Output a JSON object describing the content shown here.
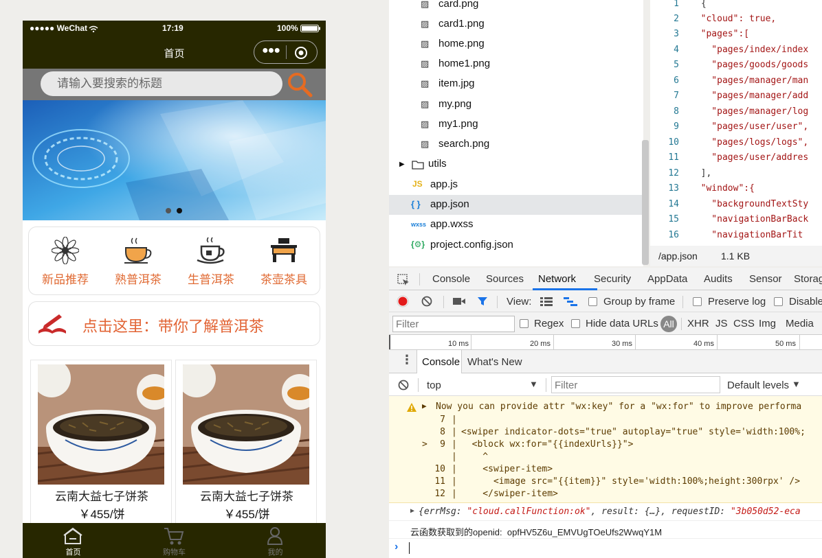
{
  "phone": {
    "status": {
      "carrier": "●●●●● WeChat",
      "time": "17:19",
      "battery": "100%"
    },
    "nav_title": "首页",
    "search_placeholder": "请输入要搜索的标题",
    "categories": [
      {
        "label": "新品推荐",
        "icon": "flower-icon"
      },
      {
        "label": "熟普洱茶",
        "icon": "hot-tea-cup-icon"
      },
      {
        "label": "生普洱茶",
        "icon": "teapot-icon"
      },
      {
        "label": "茶壶茶具",
        "icon": "tea-table-icon"
      }
    ],
    "promo_text": "点击这里：带你了解普洱茶",
    "products": [
      {
        "name": "云南大益七子饼茶",
        "price": "￥455/饼"
      },
      {
        "name": "云南大益七子饼茶",
        "price": "￥455/饼"
      }
    ],
    "tabs": [
      {
        "label": "首页",
        "icon": "home-icon",
        "active": true
      },
      {
        "label": "购物车",
        "icon": "cart-icon",
        "active": false
      },
      {
        "label": "我的",
        "icon": "user-icon",
        "active": false
      }
    ],
    "colors": {
      "navbar": "#272700",
      "accent": "#e06a33"
    }
  },
  "file_tree": {
    "items": [
      {
        "name": "card.png",
        "type": "image"
      },
      {
        "name": "card1.png",
        "type": "image"
      },
      {
        "name": "home.png",
        "type": "image"
      },
      {
        "name": "home1.png",
        "type": "image"
      },
      {
        "name": "item.jpg",
        "type": "image"
      },
      {
        "name": "my.png",
        "type": "image"
      },
      {
        "name": "my1.png",
        "type": "image"
      },
      {
        "name": "search.png",
        "type": "image"
      },
      {
        "name": "utils",
        "type": "folder"
      },
      {
        "name": "app.js",
        "type": "js"
      },
      {
        "name": "app.json",
        "type": "json",
        "selected": true
      },
      {
        "name": "app.wxss",
        "type": "wxss"
      },
      {
        "name": "project.config.json",
        "type": "config"
      }
    ],
    "type_labels": {
      "js": "JS",
      "json": "{ }",
      "wxss": "wxss",
      "config": "{⚙}"
    }
  },
  "editor": {
    "lines": [
      {
        "n": "1",
        "text": "{"
      },
      {
        "n": "2",
        "text": "  \"cloud\": true,"
      },
      {
        "n": "3",
        "text": "  \"pages\":["
      },
      {
        "n": "4",
        "text": "    \"pages/index/index"
      },
      {
        "n": "5",
        "text": "    \"pages/goods/goods"
      },
      {
        "n": "6",
        "text": "    \"pages/manager/man"
      },
      {
        "n": "7",
        "text": "    \"pages/manager/add"
      },
      {
        "n": "8",
        "text": "    \"pages/manager/log"
      },
      {
        "n": "9",
        "text": "    \"pages/user/user\","
      },
      {
        "n": "10",
        "text": "    \"pages/logs/logs\","
      },
      {
        "n": "11",
        "text": "    \"pages/user/addres"
      },
      {
        "n": "12",
        "text": "  ],"
      },
      {
        "n": "13",
        "text": "  \"window\":{"
      },
      {
        "n": "14",
        "text": "    \"backgroundTextSty"
      },
      {
        "n": "15",
        "text": "    \"navigationBarBack"
      },
      {
        "n": "16",
        "text": "    \"navigationBarTit"
      }
    ],
    "status_path": "/app.json",
    "status_size": "1.1 KB"
  },
  "devtools": {
    "tabs": [
      "Console",
      "Sources",
      "Network",
      "Security",
      "AppData",
      "Audits",
      "Sensor",
      "Storag"
    ],
    "active_tab": "Network",
    "view_label": "View:",
    "group_by_frame": "Group by frame",
    "preserve_log": "Preserve log",
    "disable_cache": "Disable",
    "filter_placeholder": "Filter",
    "regex": "Regex",
    "hide_data_urls": "Hide data URLs",
    "types": [
      "All",
      "XHR",
      "JS",
      "CSS",
      "Img",
      "Media"
    ],
    "timeline_ticks": [
      "10 ms",
      "20 ms",
      "30 ms",
      "40 ms",
      "50 ms"
    ],
    "drawer_tabs": [
      "Console",
      "What's New"
    ],
    "context": "top",
    "console_filter_placeholder": "Filter",
    "levels": "Default levels",
    "warning": {
      "message": "Now you can provide attr \"wx:key\" for a \"wx:for\" to improve performa",
      "code": [
        {
          "n": "7",
          "marker": "",
          "text": ""
        },
        {
          "n": "8",
          "marker": "",
          "text": "<swiper indicator-dots=\"true\" autoplay=\"true\" style='width:100%;"
        },
        {
          "n": "9",
          "marker": ">",
          "text": "  <block wx:for=\"{{indexUrls}}\">"
        },
        {
          "n": "",
          "marker": "",
          "text": "    ^"
        },
        {
          "n": "10",
          "marker": "",
          "text": "    <swiper-item>"
        },
        {
          "n": "11",
          "marker": "",
          "text": "      <image src=\"{{item}}\" style='width:100%;height:300rpx' />"
        },
        {
          "n": "12",
          "marker": "",
          "text": "    </swiper-item>"
        }
      ]
    },
    "log_object": {
      "prefix": "{errMsg: ",
      "errmsg": "\"cloud.callFunction:ok\"",
      "mid": ", result: {…}, requestID: ",
      "reqid": "\"3b050d52-eca"
    },
    "log_openid": "云函数获取到的openid:  opfHV5Z6u_EMVUgTOeUfs2WwqY1M",
    "prompt": "›"
  }
}
